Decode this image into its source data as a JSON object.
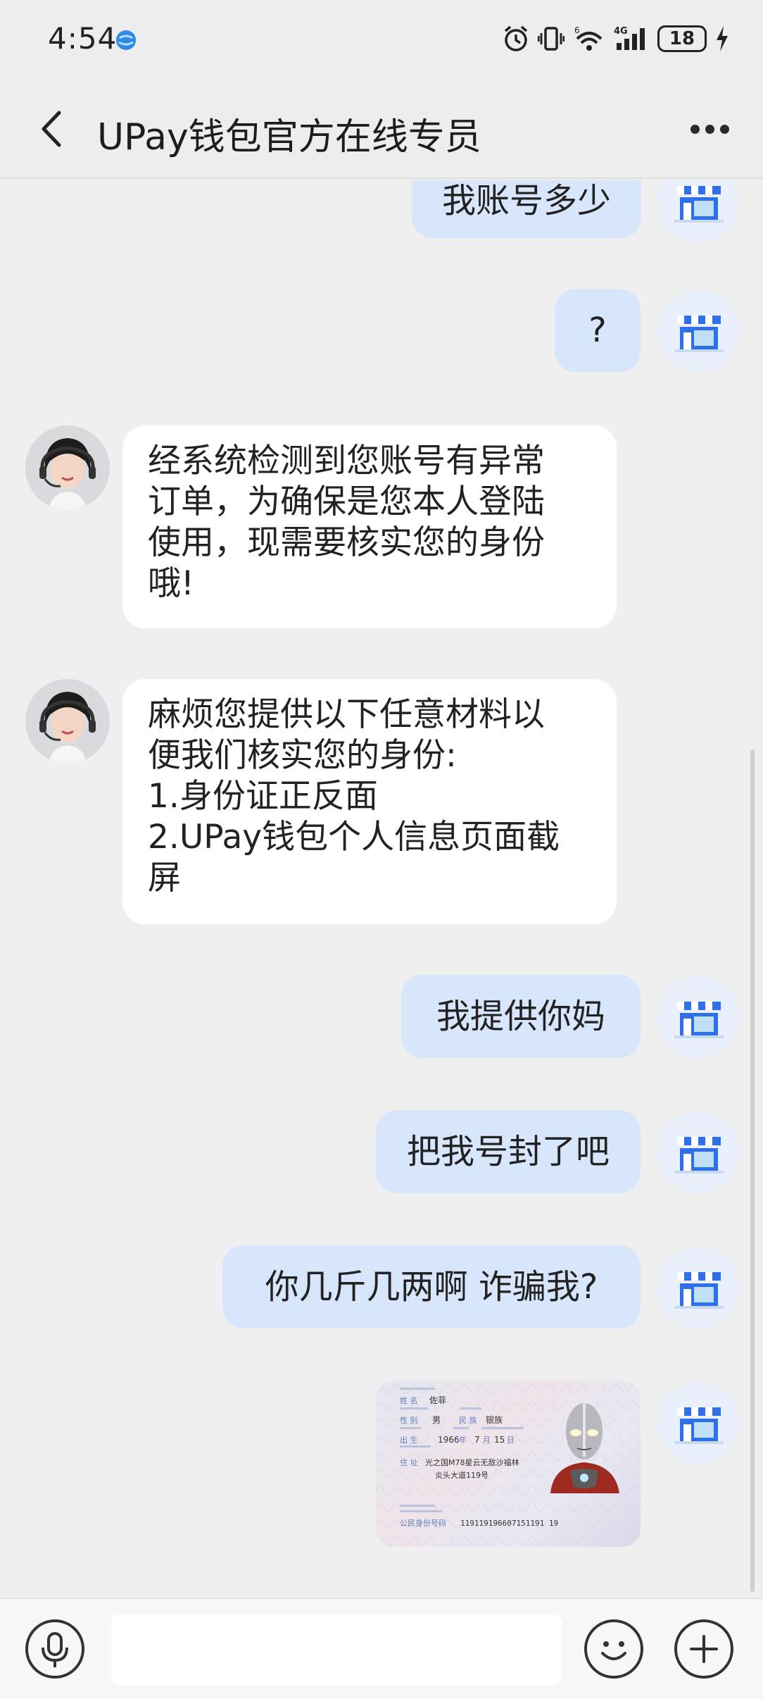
{
  "status_bar": {
    "time": "4:54",
    "battery": "18",
    "network": "4G"
  },
  "header": {
    "title": "UPay钱包官方在线专员"
  },
  "messages": [
    {
      "direction": "out",
      "type": "text",
      "text": "我账号多少"
    },
    {
      "direction": "out",
      "type": "text",
      "text": "?"
    },
    {
      "direction": "in",
      "type": "text",
      "lines": [
        "经系统检测到您账号有异常",
        "订单，为确保是您本人登陆",
        "使用，现需要核实您的身份",
        "哦!"
      ]
    },
    {
      "direction": "in",
      "type": "text",
      "lines": [
        "麻烦您提供以下任意材料以",
        "便我们核实您的身份:",
        "1.身份证正反面",
        "2.UPay钱包个人信息页面截",
        "屏"
      ]
    },
    {
      "direction": "out",
      "type": "text",
      "text": "我提供你妈"
    },
    {
      "direction": "out",
      "type": "text",
      "text": "把我号封了吧"
    },
    {
      "direction": "out",
      "type": "text",
      "text": "你几斤几两啊 诈骗我?"
    },
    {
      "direction": "out",
      "type": "image",
      "id_card": {
        "name_label": "姓 名",
        "name": "佐菲",
        "sex_label": "性 别",
        "sex": "男",
        "ethnic_label": "民 族",
        "ethnic": "银族",
        "birth_label": "出 生",
        "birth_year": "1966",
        "year_char": "年",
        "birth_month": "7",
        "month_char": "月",
        "birth_day": "15",
        "day_char": "日",
        "address_label": "住 址",
        "address_line1": "光之国M78星云无敌沙福林",
        "address_line2": "炎头大道119号",
        "id_label": "公民身份号码",
        "id_number": "119119196607151191 19"
      }
    }
  ],
  "input": {
    "placeholder": ""
  },
  "icons": {
    "back": "chevron-left-icon",
    "more": "more-dots-icon",
    "voice": "microphone-icon",
    "emoji": "emoji-icon",
    "add": "plus-icon",
    "store_avatar": "store-icon"
  },
  "colors": {
    "outgoing_bubble": "#d8e6fb",
    "incoming_bubble": "#ffffff",
    "background": "#efefef",
    "store_blue": "#2f6fe8"
  }
}
